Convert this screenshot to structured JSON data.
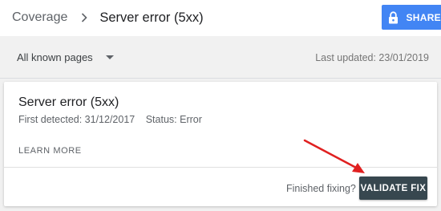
{
  "header": {
    "breadcrumb_parent": "Coverage",
    "breadcrumb_current": "Server error (5xx)",
    "share_label": "SHARE",
    "share_icon": "lock-icon"
  },
  "filter": {
    "selected": "All known pages",
    "last_updated": "Last updated: 23/01/2019"
  },
  "card": {
    "title": "Server error (5xx)",
    "first_detected": "First detected: 31/12/2017",
    "status": "Status: Error",
    "learn_more": "LEARN MORE",
    "finished_label": "Finished fixing?",
    "validate_label": "VALIDATE FIX"
  },
  "colors": {
    "share_bg": "#4285f4",
    "validate_bg": "#37474f",
    "annotation_arrow": "#e02020"
  }
}
